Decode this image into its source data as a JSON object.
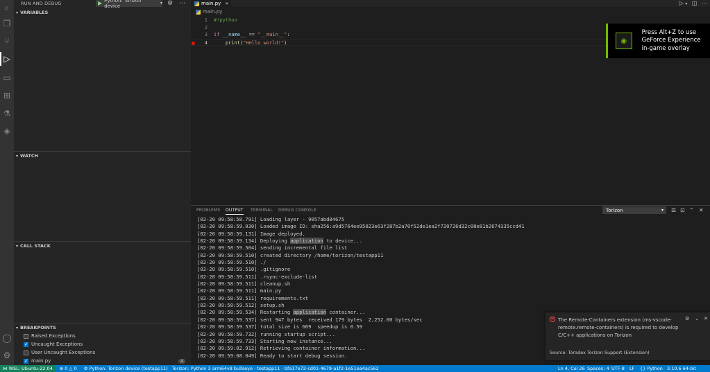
{
  "sidebar": {
    "title": "RUN AND DEBUG",
    "run_config": "Python: Torizon device",
    "sections": {
      "variables": "VARIABLES",
      "watch": "WATCH",
      "call_stack": "CALL STACK",
      "breakpoints": "BREAKPOINTS"
    },
    "breakpoints": [
      {
        "label": "Raised Exceptions",
        "checked": false
      },
      {
        "label": "Uncaught Exceptions",
        "checked": true
      },
      {
        "label": "User Uncaught Exceptions",
        "checked": false
      },
      {
        "label": "main.py",
        "checked": true,
        "badge": "4"
      }
    ]
  },
  "editor": {
    "tab_label": "main.py",
    "breadcrumb": "main.py",
    "lines": [
      {
        "num": "1"
      },
      {
        "num": "2"
      },
      {
        "num": "3"
      },
      {
        "num": "4"
      }
    ],
    "code": {
      "l1": "#!python",
      "l3_kw": "if",
      "l3_var": "__name__",
      "l3_op": "==",
      "l3_str": "\"__main__\"",
      "l3_colon": ":",
      "l4_fn": "print",
      "l4_open": "(",
      "l4_str": "\"Hello world!\"",
      "l4_close": ")"
    }
  },
  "overlay": {
    "message": "Press Alt+Z to use GeForce Experience in-game overlay"
  },
  "panel": {
    "tabs": [
      "PROBLEMS",
      "OUTPUT",
      "TERMINAL",
      "DEBUG CONSOLE"
    ],
    "output_channel": "Torizon",
    "output": [
      {
        "pre": "[02-20 09:58:58.791] Loading layer - 9057abd84675",
        "hl": "",
        "post": ""
      },
      {
        "pre": "[02-20 09:58:59.030] Loaded image ID: sha256:a9d5764ee95023e63f287b2a70f52de1ea2f720726d32c08e81b2674335ccd41",
        "hl": "",
        "post": ""
      },
      {
        "pre": "[02-20 09:58:59.131] Image deployed.",
        "hl": "",
        "post": ""
      },
      {
        "pre": "[02-20 09:58:59.134] Deploying ",
        "hl": "application",
        "post": " to device..."
      },
      {
        "pre": "[02-20 09:58:59.504] sending incremental file list",
        "hl": "",
        "post": ""
      },
      {
        "pre": "[02-20 09:58:59.510] created directory /home/torizon/testapp11",
        "hl": "",
        "post": ""
      },
      {
        "pre": "[02-20 09:58:59.510] ./",
        "hl": "",
        "post": ""
      },
      {
        "pre": "[02-20 09:58:59.510] .gitignore",
        "hl": "",
        "post": ""
      },
      {
        "pre": "[02-20 09:58:59.511] .rsync-exclude-list",
        "hl": "",
        "post": ""
      },
      {
        "pre": "[02-20 09:58:59.511] cleanup.sh",
        "hl": "",
        "post": ""
      },
      {
        "pre": "[02-20 09:58:59.511] main.py",
        "hl": "",
        "post": ""
      },
      {
        "pre": "[02-20 09:58:59.511] requirements.txt",
        "hl": "",
        "post": ""
      },
      {
        "pre": "[02-20 09:58:59.512] setup.sh",
        "hl": "",
        "post": ""
      },
      {
        "pre": "[02-20 09:58:59.534] Restarting ",
        "hl": "application",
        "post": " container..."
      },
      {
        "pre": "[02-20 09:58:59.537] sent 947 bytes  received 179 bytes  2,252.00 bytes/sec",
        "hl": "",
        "post": ""
      },
      {
        "pre": "[02-20 09:58:59.537] total size is 669  speedup is 0.59",
        "hl": "",
        "post": ""
      },
      {
        "pre": "[02-20 09:58:59.732] running startup script...",
        "hl": "",
        "post": ""
      },
      {
        "pre": "[02-20 09:58:59.733] Starting new instance...",
        "hl": "",
        "post": ""
      },
      {
        "pre": "[02-20 09:59:02.912] Retrieving container information...",
        "hl": "",
        "post": ""
      },
      {
        "pre": "[02-20 09:59:08.049] Ready to start debug session.",
        "hl": "",
        "post": ""
      }
    ]
  },
  "notification": {
    "message": "The Remote-Containers extension (ms-vscode-remote.remote-containers) is required to develop C/C++ applications on Torizon",
    "source": "Source: Toradex Torizon Support (Extension)"
  },
  "status": {
    "remote": "WSL: Ubuntu-22.04",
    "errors": "0",
    "warnings": "0",
    "debug_config": "Python: Torizon device (testapp11)",
    "torizon": "Torizon: Python 3 arm64v8 bullseye - testapp11 - bfa17e72-cd01-4679-a1f2-1e51ea4ac562",
    "position": "Ln 4, Col 26",
    "spaces": "Spaces: 4",
    "encoding": "UTF-8",
    "eol": "LF",
    "language": "Python",
    "interpreter": "3.10.6 64-bit"
  },
  "colors": {
    "status_bar": "#007acc",
    "remote_indicator": "#16825d",
    "breakpoint": "#e51400",
    "nvidia_green": "#76b900"
  },
  "icons": [
    "search-icon",
    "explorer-icon",
    "source-control-icon",
    "run-debug-icon",
    "remote-explorer-icon",
    "extensions-icon",
    "testing-icon",
    "torizon-icon",
    "account-icon",
    "gear-icon"
  ]
}
